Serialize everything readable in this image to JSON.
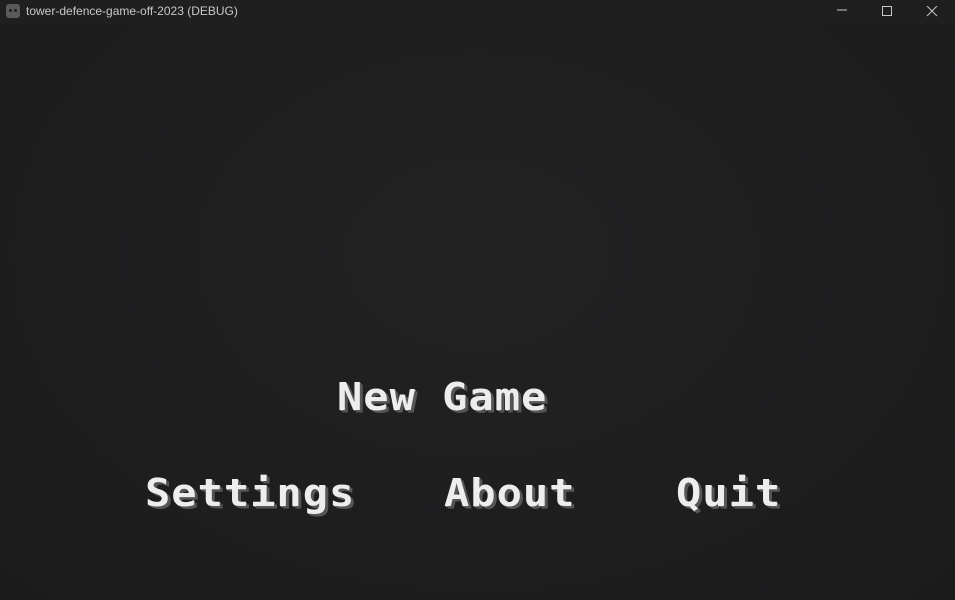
{
  "window": {
    "title": "tower-defence-game-off-2023 (DEBUG)",
    "icon": "godot-icon",
    "controls": [
      "minimize-icon",
      "maximize-icon",
      "close-icon"
    ]
  },
  "menu": {
    "new_game": "New Game",
    "settings": "Settings",
    "about": "About",
    "quit": "Quit"
  },
  "colors": {
    "background": "#1e1e1f",
    "titlebar": "#1f1f1f",
    "text": "#ededed",
    "shadow": "#555555"
  }
}
